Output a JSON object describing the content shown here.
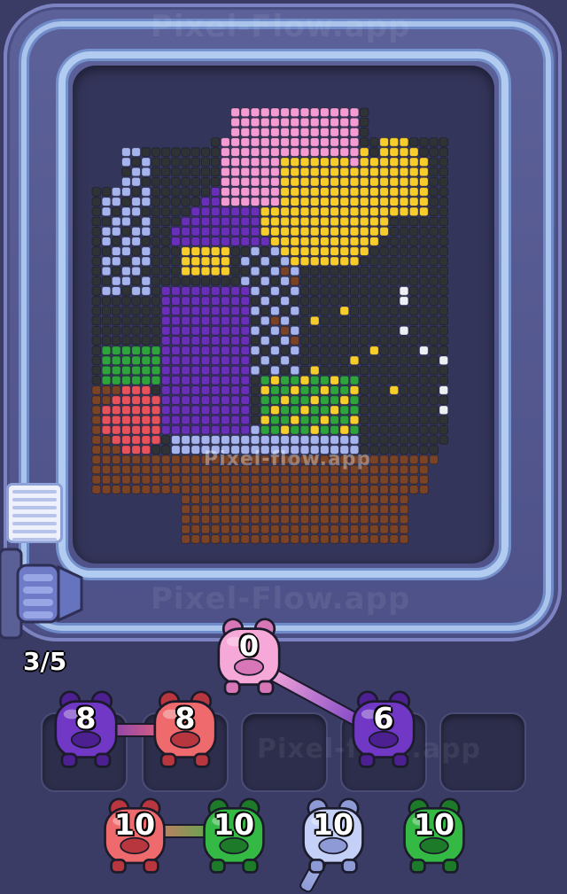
{
  "watermark": "Pixel-Flow.app",
  "watermark_small": "Pixel-flow.app",
  "progress": {
    "text": "3/5"
  },
  "pixel_art_colors": {
    "black": "#2f3336",
    "pink": "#f39bd2",
    "yellow": "#f6cd2a",
    "purple": "#6a2fb8",
    "lavender": "#a6b4ee",
    "red": "#e8525a",
    "green": "#2fa33c",
    "brown": "#7a4325",
    "white": "#eef0f6"
  },
  "queue_pig": {
    "color": "pink",
    "count": "0"
  },
  "slot_pigs": [
    {
      "color": "purple",
      "count": "8"
    },
    {
      "color": "red",
      "count": "8"
    },
    {
      "color": "purple",
      "count": "6"
    }
  ],
  "bottom_pigs": [
    {
      "color": "red",
      "count": "10"
    },
    {
      "color": "green",
      "count": "10"
    },
    {
      "color": "lavender",
      "count": "10"
    },
    {
      "color": "green",
      "count": "10"
    }
  ]
}
